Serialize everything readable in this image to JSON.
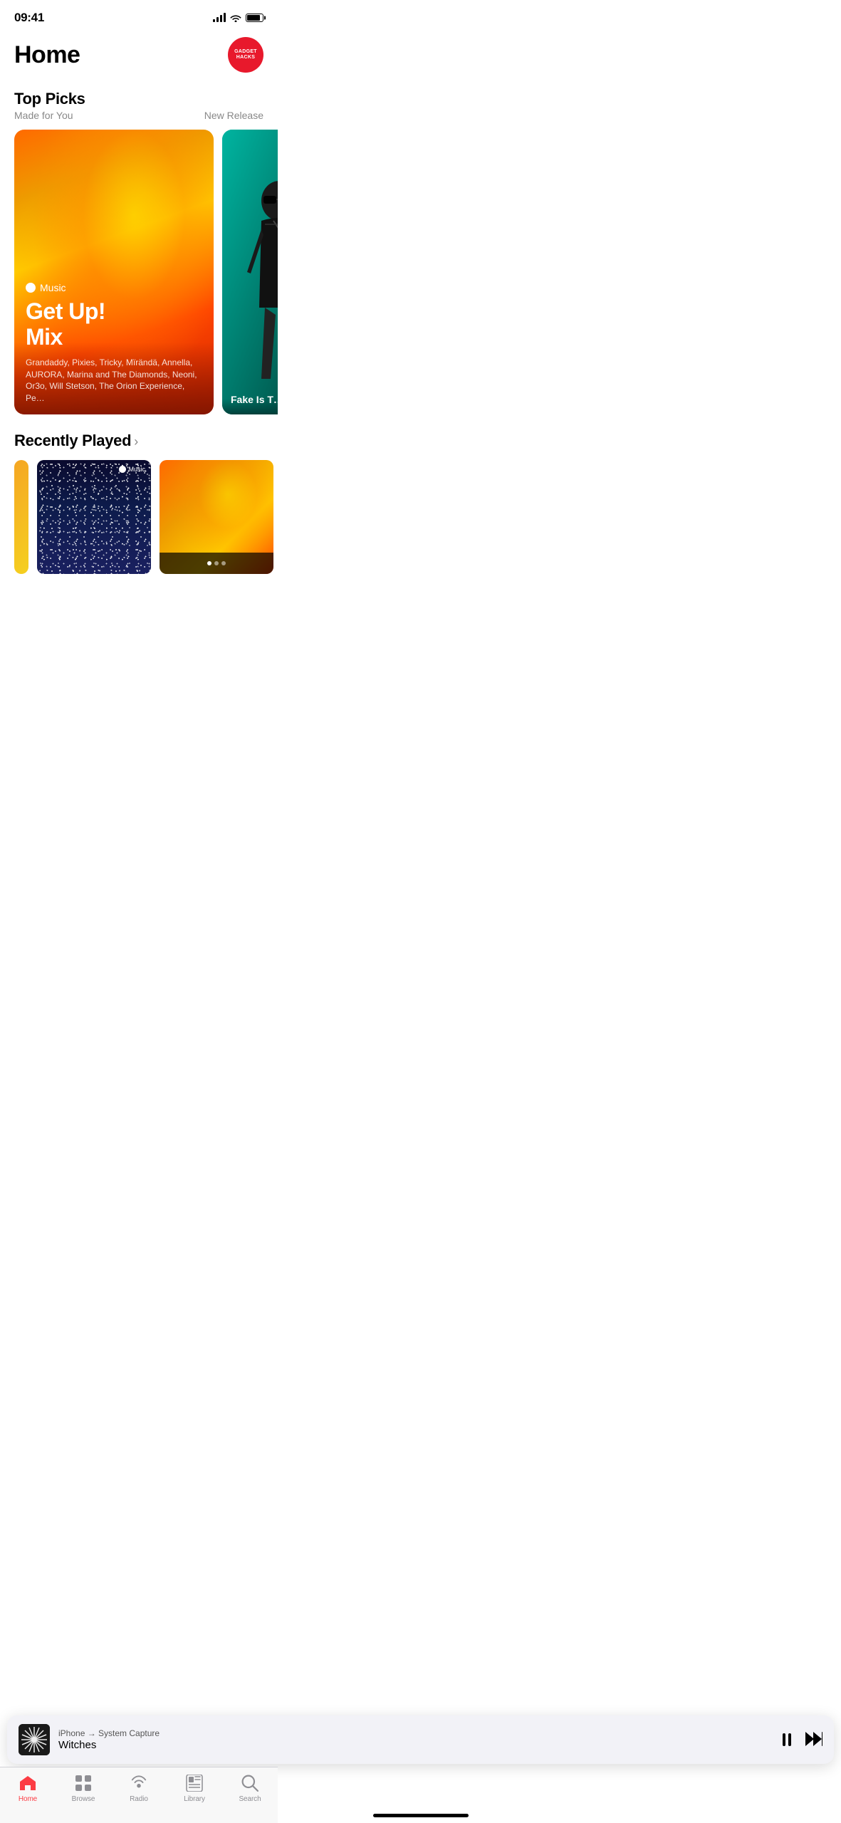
{
  "statusBar": {
    "time": "09:41"
  },
  "header": {
    "title": "Home",
    "badgeLine1": "GADGET",
    "badgeLine2": "HACKS"
  },
  "topPicks": {
    "sectionTitle": "Top Picks",
    "subtitle": "Made for You",
    "linkText": "New Release",
    "mainCard": {
      "appleMusicLabel": "Music",
      "titleLine1": "Get Up!",
      "titleLine2": "Mix",
      "description": "Grandaddy, Pixies, Tricky, Mïrändä, Annella, AURORA, Marina and The Diamonds, Neoni, Or3o, Will Stetson, The Orion Experience, Pe…"
    },
    "secondCard": {
      "title": "Fake Is T… H…"
    }
  },
  "recentlyPlayed": {
    "sectionTitle": "Recently Played"
  },
  "nowPlaying": {
    "device": "iPhone → System Capture",
    "title": "Witches",
    "arrowSymbol": "→"
  },
  "tabBar": {
    "items": [
      {
        "label": "Home",
        "active": true
      },
      {
        "label": "Browse",
        "active": false
      },
      {
        "label": "Radio",
        "active": false
      },
      {
        "label": "Library",
        "active": false
      },
      {
        "label": "Search",
        "active": false
      }
    ]
  }
}
